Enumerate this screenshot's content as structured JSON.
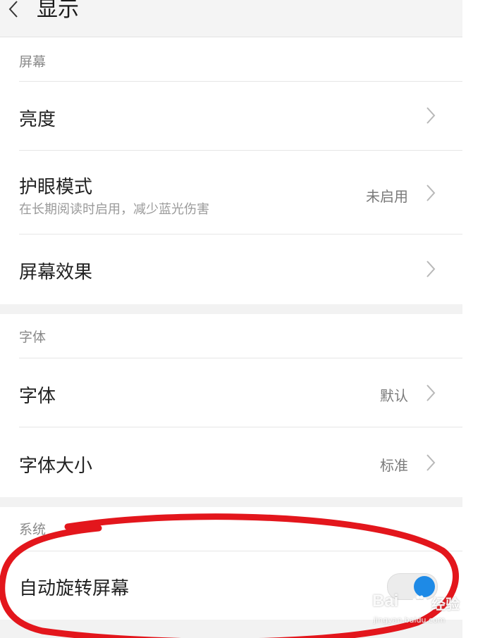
{
  "header": {
    "back_icon": "chevron-left-icon",
    "title": "显示"
  },
  "sections": {
    "screen": {
      "label": "屏幕",
      "brightness": {
        "title": "亮度",
        "icon": "chevron-right-icon"
      },
      "eye_care": {
        "title": "护眼模式",
        "subtitle": "在长期阅读时启用，减少蓝光伤害",
        "value": "未启用",
        "icon": "chevron-right-icon"
      },
      "screen_effect": {
        "title": "屏幕效果",
        "icon": "chevron-right-icon"
      }
    },
    "font": {
      "label": "字体",
      "font_face": {
        "title": "字体",
        "value": "默认",
        "icon": "chevron-right-icon"
      },
      "font_size": {
        "title": "字体大小",
        "value": "标准",
        "icon": "chevron-right-icon"
      }
    },
    "system": {
      "label": "系统",
      "auto_rotate": {
        "title": "自动旋转屏幕",
        "enabled": true
      }
    }
  },
  "colors": {
    "accent": "#1e8ae6",
    "annotation": "#e3161c"
  },
  "watermark": {
    "brand": "Bai",
    "brand2": "经验",
    "url": "jingyan.baidu.com"
  }
}
